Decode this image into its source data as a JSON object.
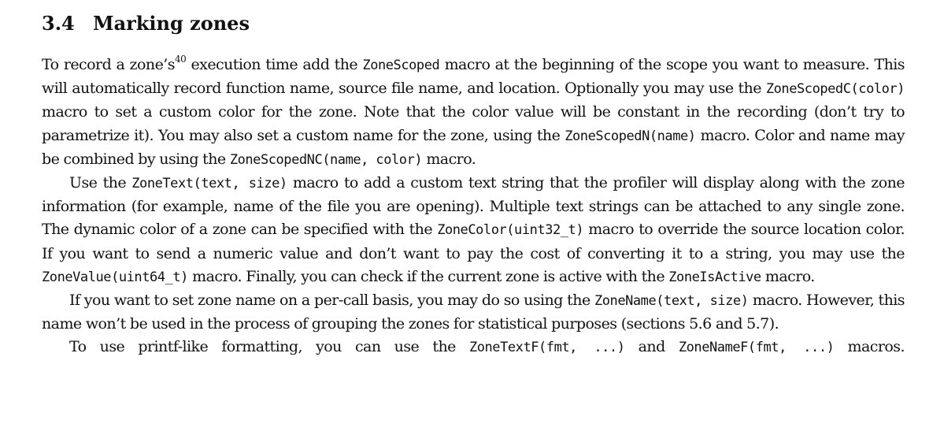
{
  "section": {
    "number": "3.4",
    "title": "Marking zones"
  },
  "p1": {
    "t1": "To record a zone’s",
    "footnote": "40",
    "t2": " execution time add the ",
    "c1": "ZoneScoped",
    "t3": " macro at the beginning of the scope you want to measure. This will automatically record function name, source file name, and location. Optionally you may use the ",
    "c2": "ZoneScopedC(color)",
    "t4": " macro to set a custom color for the zone. Note that the color value will be constant in the recording (don’t try to parametrize it). You may also set a custom name for the zone, using the ",
    "c3": "ZoneScopedN(name)",
    "t5": " macro. Color and name may be combined by using the ",
    "c4": "ZoneScopedNC(name, color)",
    "t6": " macro."
  },
  "p2": {
    "t1": "Use the ",
    "c1": "ZoneText(text, size)",
    "t2": " macro to add a custom text string that the profiler will display along with the zone information (for example, name of the file you are opening). Multiple text strings can be attached to any single zone. The dynamic color of a zone can be specified with the ",
    "c2": "ZoneColor(uint32_t)",
    "t3": " macro to override the source location color. If you want to send a numeric value and don’t want to pay the cost of converting it to a string, you may use the ",
    "c3": "ZoneValue(uint64_t)",
    "t4": " macro. Finally, you can check if the current zone is active with the ",
    "c4": "ZoneIsActive",
    "t5": " macro."
  },
  "p3": {
    "t1": "If you want to set zone name on a per-call basis, you may do so using the ",
    "c1": "ZoneName(text, size)",
    "t2": " macro. However, this name won’t be used in the process of grouping the zones for statistical purposes (sections 5.6 and 5.7)."
  },
  "p4": {
    "t1": "To use printf-like formatting, you can use the ",
    "c1": "ZoneTextF(fmt, ...)",
    "t2": " and ",
    "c2": "ZoneNameF(fmt, ...)",
    "t3": " macros."
  }
}
